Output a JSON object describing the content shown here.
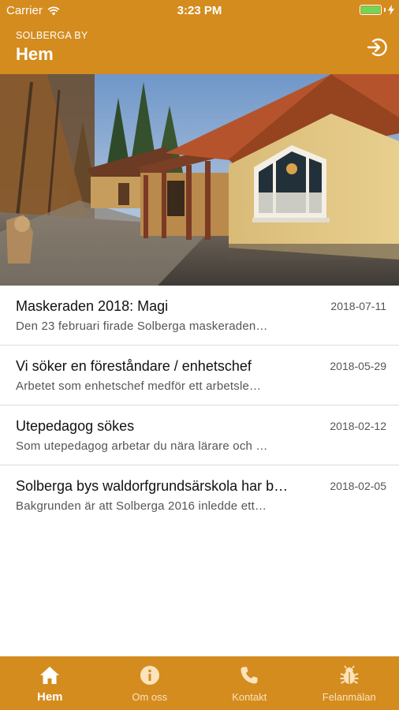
{
  "status_bar": {
    "carrier": "Carrier",
    "time": "3:23 PM"
  },
  "header": {
    "subtitle": "SOLBERGA BY",
    "title": "Hem"
  },
  "hero": {
    "icon": "school-building-photo"
  },
  "news": [
    {
      "title": "Maskeraden 2018: Magi",
      "date": "2018-07-11",
      "excerpt": "Den 23 februari firade Solberga maskeraden…"
    },
    {
      "title": "Vi söker en föreståndare / enhetschef",
      "date": "2018-05-29",
      "excerpt": "Arbetet som enhetschef medför ett arbetsle…"
    },
    {
      "title": "Utepedagog sökes",
      "date": "2018-02-12",
      "excerpt": "Som utepedagog arbetar du nära lärare och …"
    },
    {
      "title": "Solberga bys waldorfgrundsärskola har b…",
      "date": "2018-02-05",
      "excerpt": "Bakgrunden är att Solberga 2016 inledde ett…"
    }
  ],
  "tabs": [
    {
      "label": "Hem",
      "icon": "home-icon",
      "active": true
    },
    {
      "label": "Om oss",
      "icon": "info-icon",
      "active": false
    },
    {
      "label": "Kontakt",
      "icon": "phone-icon",
      "active": false
    },
    {
      "label": "Felanmälan",
      "icon": "bug-icon",
      "active": false
    }
  ],
  "colors": {
    "brand": "#d48c1f",
    "battery": "#6fd65a"
  }
}
